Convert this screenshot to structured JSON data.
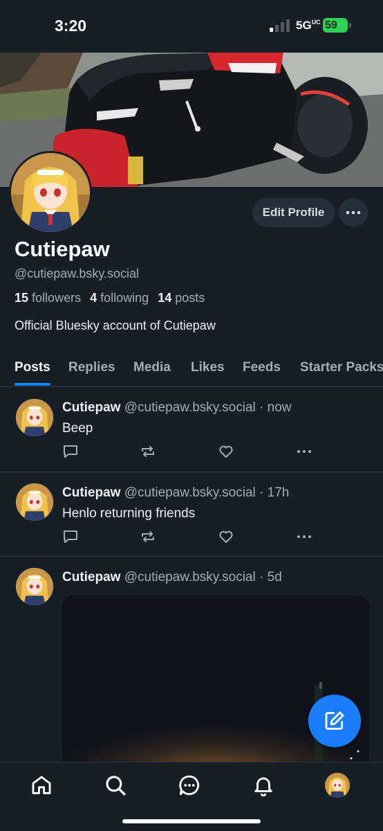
{
  "status_bar": {
    "time": "3:20",
    "network": "5G",
    "network_sub": "UC",
    "battery": "59"
  },
  "profile": {
    "edit_label": "Edit Profile",
    "name": "Cutiepaw",
    "handle": "@cutiepaw.bsky.social",
    "followers_count": "15",
    "followers_label": "followers",
    "following_count": "4",
    "following_label": "following",
    "posts_count": "14",
    "posts_label": "posts",
    "bio": "Official Bluesky account of Cutiepaw"
  },
  "tabs": [
    {
      "label": "Posts",
      "active": true
    },
    {
      "label": "Replies"
    },
    {
      "label": "Media"
    },
    {
      "label": "Likes"
    },
    {
      "label": "Feeds"
    },
    {
      "label": "Starter Packs"
    }
  ],
  "posts": [
    {
      "author": "Cutiepaw",
      "handle": "@cutiepaw.bsky.social",
      "sep": "·",
      "time": "now",
      "text": "Beep"
    },
    {
      "author": "Cutiepaw",
      "handle": "@cutiepaw.bsky.social",
      "sep": "·",
      "time": "17h",
      "text": "Henlo returning friends"
    },
    {
      "author": "Cutiepaw",
      "handle": "@cutiepaw.bsky.social",
      "sep": "·",
      "time": "5d",
      "text": ""
    }
  ],
  "icons": {
    "reply": "speech-bubble-icon",
    "repost": "repost-arrows-icon",
    "like": "heart-icon",
    "more": "ellipsis-icon",
    "compose": "compose-pencil-icon",
    "nav": [
      "home-icon",
      "search-icon",
      "chat-icon",
      "bell-icon",
      "profile-avatar"
    ]
  },
  "colors": {
    "background": "#161e27",
    "accent": "#1083fe",
    "muted": "#a4acb6",
    "battery": "#2fd158"
  }
}
